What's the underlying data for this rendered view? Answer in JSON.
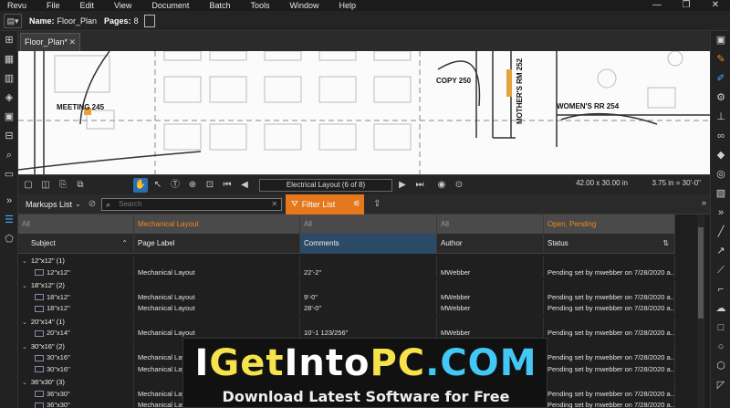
{
  "menu": [
    "Revu",
    "File",
    "Edit",
    "View",
    "Document",
    "Batch",
    "Tools",
    "Window",
    "Help"
  ],
  "window_controls": [
    "—",
    "❐",
    "✕"
  ],
  "doc": {
    "name_label": "Name:",
    "name": "Floor_Plan",
    "pages_label": "Pages:",
    "pages": "8"
  },
  "tabs": [
    {
      "label": "Floor_Plan*",
      "close": "✕"
    }
  ],
  "drawing": {
    "labels": [
      "MEETING  245",
      "COPY  250",
      "MOTHER'S RM  252",
      "WOMEN'S RR  254"
    ]
  },
  "nav": {
    "page_label": "Electrical Layout (6 of 8)",
    "dimensions": "42.00 x 30.00 in",
    "scale": "3.75 in = 30'-0\""
  },
  "markups": {
    "title": "Markups List",
    "search_placeholder": "Search",
    "filter_label": "Filter List"
  },
  "filter_row": [
    "All",
    "Mechanical Layout",
    "All",
    "All",
    "Open, Pending"
  ],
  "columns": [
    "Subject",
    "Page Label",
    "Comments",
    "Author",
    "Status"
  ],
  "rows": [
    {
      "type": "group",
      "subject": "12\"x12\" (1)"
    },
    {
      "type": "item",
      "subject": "12\"x12\"",
      "page": "Mechanical Layout",
      "comments": "22'-2\"",
      "author": "MWebber",
      "status": "Pending set by mwebber on 7/28/2020 a..."
    },
    {
      "type": "group",
      "subject": "18\"x12\" (2)"
    },
    {
      "type": "item",
      "subject": "18\"x12\"",
      "page": "Mechanical Layout",
      "comments": "9'-0\"",
      "author": "MWebber",
      "status": "Pending set by mwebber on 7/28/2020 a..."
    },
    {
      "type": "item",
      "subject": "18\"x12\"",
      "page": "Mechanical Layout",
      "comments": "28'-0\"",
      "author": "MWebber",
      "status": "Pending set by mwebber on 7/28/2020 a..."
    },
    {
      "type": "group",
      "subject": "20\"x14\" (1)"
    },
    {
      "type": "item",
      "subject": "20\"x14\"",
      "page": "Mechanical Layout",
      "comments": "10'-1 123/256\"",
      "author": "MWebber",
      "status": "Pending set by mwebber on 7/28/2020 a..."
    },
    {
      "type": "group",
      "subject": "30\"x16\" (2)"
    },
    {
      "type": "item",
      "subject": "30\"x16\"",
      "page": "Mechanical Layo",
      "comments": "",
      "author": "",
      "status": "Pending set by mwebber on 7/28/2020 a..."
    },
    {
      "type": "item",
      "subject": "30\"x16\"",
      "page": "Mechanical Layo",
      "comments": "",
      "author": "",
      "status": "Pending set by mwebber on 7/28/2020 a..."
    },
    {
      "type": "group",
      "subject": "36\"x30\" (3)"
    },
    {
      "type": "item",
      "subject": "36\"x30\"",
      "page": "Mechanical Layo",
      "comments": "",
      "author": "",
      "status": "Pending set by mwebber on 7/28/2020 a..."
    },
    {
      "type": "item",
      "subject": "36\"x30\"",
      "page": "Mechanical Layo",
      "comments": "",
      "author": "",
      "status": "Pending set by mwebber on 7/28/2020 a..."
    }
  ],
  "watermark": {
    "t1": "I",
    "t2": "Get",
    "t3": "Into",
    "t4": "PC",
    "t5": ".",
    "t6": "COM",
    "subtitle": "Download Latest Software for Free"
  },
  "colors": {
    "accent": "#e5781d",
    "selected": "#2a6fb6"
  }
}
